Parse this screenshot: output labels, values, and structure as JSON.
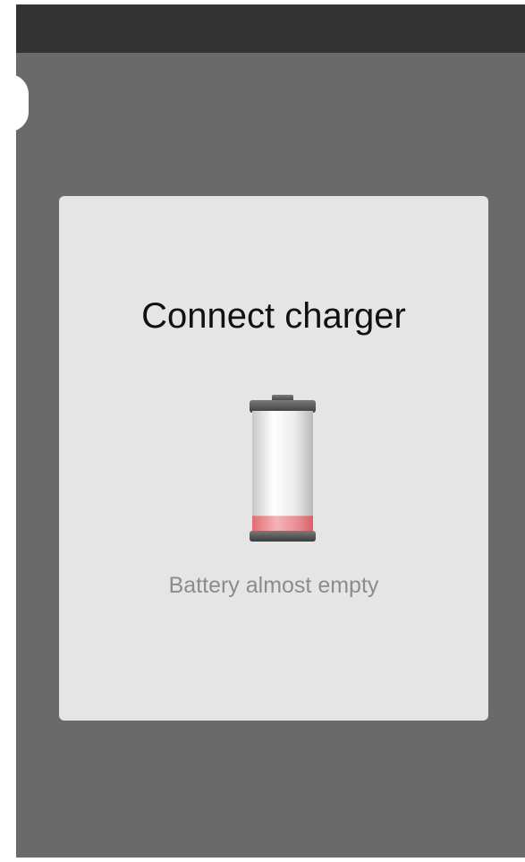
{
  "dialog": {
    "title": "Connect charger",
    "message": "Battery almost empty"
  },
  "battery": {
    "icon": "battery-low-icon",
    "charge_level": 0.15,
    "level_color": "#e8787c"
  },
  "colors": {
    "background": "#6a6a6a",
    "status_bar": "#333333",
    "dialog": "#e5e5e5",
    "title": "#111111",
    "message": "#8c8c8c"
  }
}
